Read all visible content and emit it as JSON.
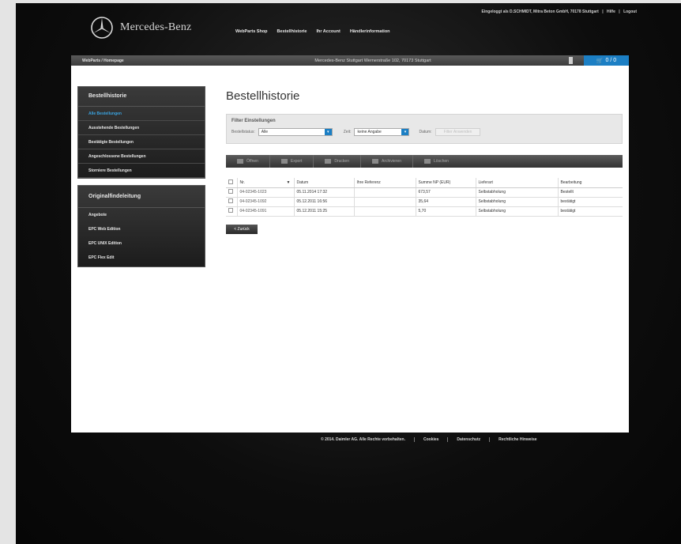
{
  "header": {
    "brand": "Mercedes-Benz",
    "utility": [
      "Eingeloggt als D.SCHMIDT, Mitra Beton GmbH, 70178 Stuttgart",
      "Hilfe",
      "Logout"
    ],
    "nav": [
      "WebParts Shop",
      "Bestellhistorie",
      "Ihr Account",
      "Händlerinformation"
    ]
  },
  "crumbbar": {
    "breadcrumb": "WebParts / Homepage",
    "dealer": "Mercedes-Benz Stuttgart Wernerstraße 102, 70173 Stuttgart",
    "cart_label": "0 / 0"
  },
  "sidebar": {
    "box1_title": "Bestellhistorie",
    "box1_items": [
      "Alle Bestellungen",
      "Ausstehende Bestellungen",
      "Bestätigte Bestellungen",
      "Angeschlossene Bestellungen",
      "Storniere Bestellungen"
    ],
    "box2_title": "Originalfindeleitung",
    "box2_items": [
      "Angebote",
      "EPC Web Edition",
      "EPC UNIX Edition",
      "EPC Flex Edit"
    ]
  },
  "main": {
    "title": "Bestellhistorie",
    "filter": {
      "title": "Filter Einstellungen",
      "label1": "Bestellstatus:",
      "value1": "Alle",
      "label2": "Zeit:",
      "value2": "keine Angabe",
      "label3": "Datum:",
      "button": "Filter Anwenden"
    },
    "toolbar": [
      "Öffnen",
      "Export",
      "Drucken",
      "Archivieren",
      "Löschen"
    ],
    "table": {
      "headers": [
        "Nr.",
        "Datum",
        "Ihre Referenz",
        "Summe NP (EUR)",
        "Lieferart",
        "Bearbeitung"
      ],
      "rows": [
        [
          "04-02345-1023",
          "05.11.2014 17:32",
          "",
          "673,57",
          "Selbstabholung",
          "Bestellt"
        ],
        [
          "04-02345-1092",
          "05.12.2011 16:56",
          "",
          "35,64",
          "Selbstabholung",
          "bestätigt"
        ],
        [
          "04-02345-1091",
          "05.12.2011 15:25",
          "",
          "5,70",
          "Selbstabholung",
          "bestätigt"
        ]
      ]
    },
    "back_button": "< Zurück"
  },
  "footer": [
    "© 2014. Daimler AG. Alle Rechte vorbehalten.",
    "Cookies",
    "Datenschutz",
    "Rechtliche Hinweise"
  ]
}
